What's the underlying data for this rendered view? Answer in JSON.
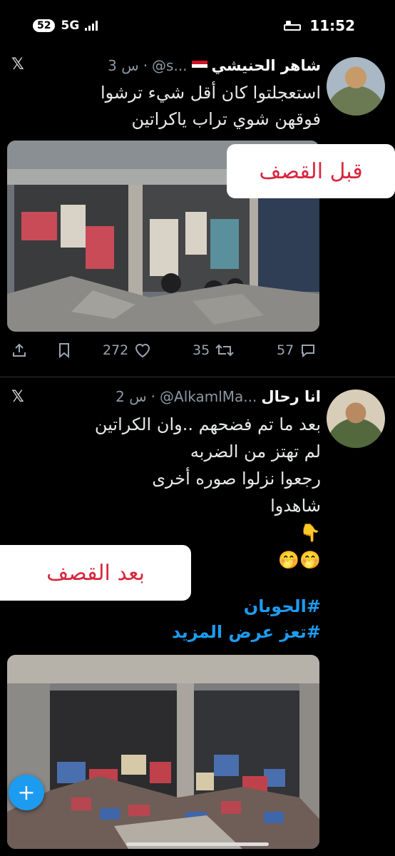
{
  "status_bar": {
    "time": "11:52",
    "network": "5G",
    "notif_count": "52"
  },
  "tweets": [
    {
      "name": "شاهر الحنيشي",
      "handle": "@s...",
      "time": "3 س",
      "text_lines": [
        "استعجلتوا كان أقل شيء ترشوا",
        "فوقهن شوي تراب  ياكراتين"
      ],
      "overlay_label": "قبل القصف",
      "actions": {
        "views": "",
        "likes": "272",
        "retweets": "35",
        "replies": "57"
      }
    },
    {
      "name": "انا رحال",
      "handle": "@AlkamlMa...",
      "time": "2 س",
      "text_lines": [
        "بعد ما تم فضحهم ..وان الكراتين",
        "لم تهتز من الضربه",
        "رجعوا نزلوا صوره أخرى",
        "شاهدوا",
        "👇",
        "🤭🤭"
      ],
      "overlay_label": "بعد القصف",
      "hashtags": [
        "#الحوبان",
        "#تعز عرض المزيد"
      ]
    }
  ],
  "colors": {
    "accent": "#1d9bf0",
    "label_red": "#d7263d",
    "background": "#000000"
  }
}
